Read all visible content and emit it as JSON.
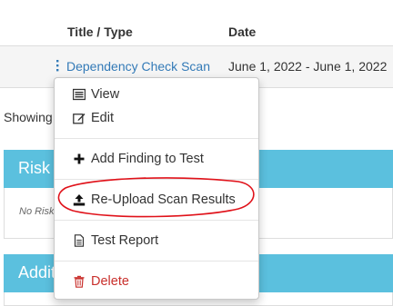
{
  "table": {
    "headers": {
      "title_type": "Title / Type",
      "date": "Date"
    },
    "row": {
      "title": "Dependency Check Scan",
      "date": "June 1, 2022 - June 1, 2022"
    }
  },
  "showing_text": "Showing",
  "panels": {
    "risk": {
      "heading": "Risk ...",
      "body_text": "No Risk..."
    },
    "additional": {
      "heading": "Additi..."
    }
  },
  "dropdown": {
    "items": [
      {
        "label": "View",
        "icon": "list-icon"
      },
      {
        "label": "Edit",
        "icon": "edit-icon"
      },
      {
        "label": "Add Finding to Test",
        "icon": "plus-icon"
      },
      {
        "label": "Re-Upload Scan Results",
        "icon": "upload-icon"
      },
      {
        "label": "Test Report",
        "icon": "file-icon"
      },
      {
        "label": "Delete",
        "icon": "trash-icon"
      }
    ]
  },
  "colors": {
    "panel_heading": "#5bc0de",
    "link": "#337ab7",
    "annotation": "#e0121a",
    "danger": "#c9302c"
  }
}
